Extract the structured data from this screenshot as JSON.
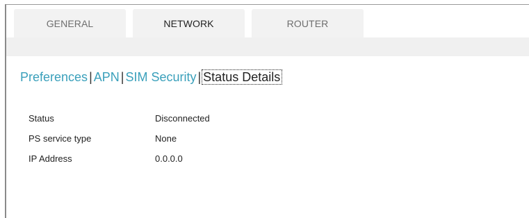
{
  "tabs": [
    {
      "label": "GENERAL",
      "active": false
    },
    {
      "label": "NETWORK",
      "active": true
    },
    {
      "label": "ROUTER",
      "active": false
    }
  ],
  "subnav": {
    "items": [
      "Preferences",
      "APN",
      "SIM Security",
      "Status Details"
    ],
    "separator": "|",
    "current": "Status Details"
  },
  "status_details": {
    "rows": [
      {
        "label": "Status",
        "value": "Disconnected"
      },
      {
        "label": "PS service type",
        "value": "None"
      },
      {
        "label": "IP Address",
        "value": "0.0.0.0"
      }
    ]
  },
  "colors": {
    "link": "#3aa0bb",
    "tab_bg": "#f2f2f2",
    "strip_bg": "#f0f0f0"
  }
}
